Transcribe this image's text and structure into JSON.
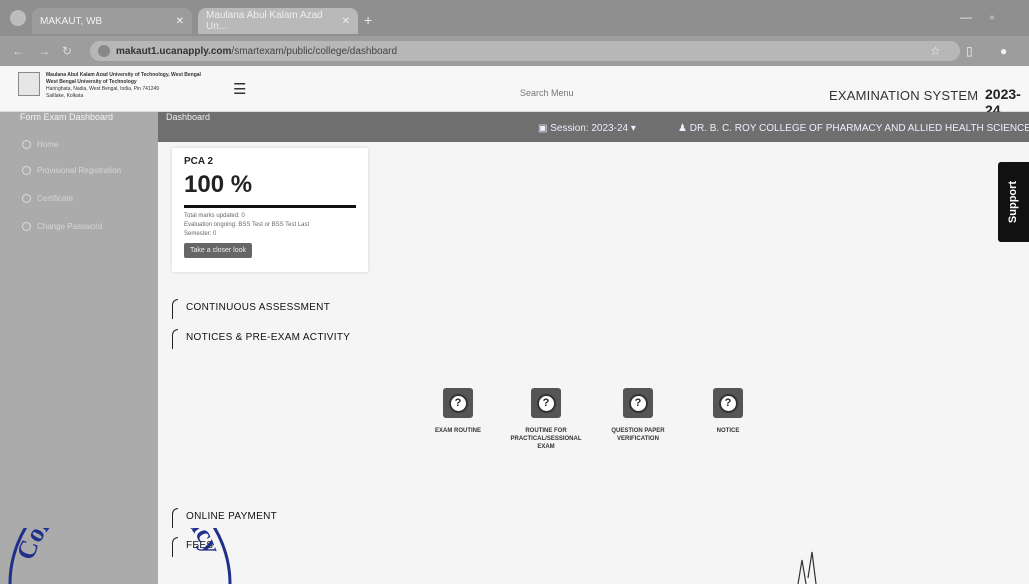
{
  "browser": {
    "tabs": [
      {
        "label": "MAKAUT, WB"
      },
      {
        "label": "Maulana Abul Kalam Azad Un..."
      }
    ],
    "new_tab": "+",
    "url_host": "makaut1.ucanapply.com",
    "url_path": "/smartexam/public/college/dashboard"
  },
  "header": {
    "university_lines": [
      "Maulana Abul Kalam Azad University of Technology, West Bengal",
      "West Bengal University of Technology",
      "Haringhata, Nadia, West Bengal, India, Pin 741249",
      "Saltlake, Kolkata"
    ],
    "menu_icon": "hamburger-icon",
    "search_label": "Search Menu",
    "exam_system": "EXAMINATION SYSTEM",
    "year": "2023-24"
  },
  "sidebar": {
    "title": "Form Exam Dashboard",
    "items": [
      {
        "label": "Home"
      },
      {
        "label": "Provisional Registration"
      },
      {
        "label": "Certificate"
      },
      {
        "label": "Change Password"
      }
    ]
  },
  "topbar": {
    "breadcrumb": "Dashboard",
    "session": "Session: 2023-24",
    "college": "DR. B. C. ROY COLLEGE OF PHARMACY AND ALLIED HEALTH SCIENCES"
  },
  "card": {
    "code": "PCA 2",
    "percent": "100 %",
    "line1": "Total marks updated: 0",
    "line2": "Evaluation ongoing: BSS Test or BSS Test Last",
    "line3": "Semester: 0",
    "button": "Take a closer look"
  },
  "sections": {
    "continuous": "CONTINUOUS ASSESSMENT",
    "notices": "NOTICES & PRE-EXAM ACTIVITY",
    "payment": "ONLINE PAYMENT",
    "fees": "FEES"
  },
  "tiles": [
    {
      "label": "EXAM ROUTINE"
    },
    {
      "label": "ROUTINE FOR PRACTICAL/SESSIONAL EXAM"
    },
    {
      "label": "QUESTION PAPER VERIFICATION"
    },
    {
      "label": "NOTICE"
    }
  ],
  "support": "Support",
  "stamp_text": "College of Pharmacy"
}
